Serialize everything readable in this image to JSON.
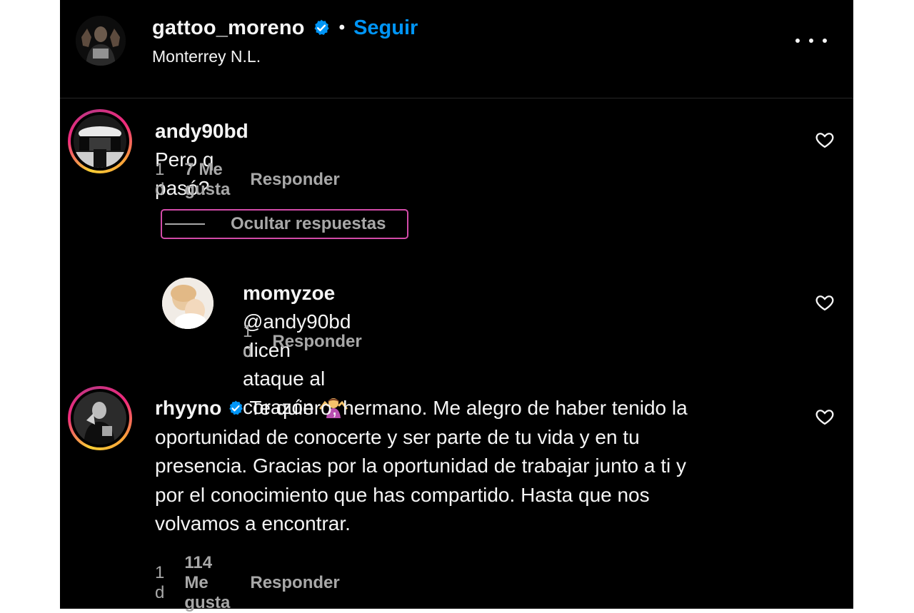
{
  "header": {
    "username": "gattoo_moreno",
    "separator": "•",
    "follow_label": "Seguir",
    "location": "Monterrey N.L.",
    "more_icon": "more-horizontal-icon"
  },
  "comments": [
    {
      "username": "andy90bd",
      "text": "Pero q pasó?",
      "time": "1 d",
      "likes": "7 Me gusta",
      "reply_label": "Responder"
    },
    {
      "username": "momyzoe",
      "text": "@andy90bd dicen ataque al corazón",
      "emoji": "🤷‍♀️",
      "time": "1 d",
      "reply_label": "Responder"
    },
    {
      "username": "rhyyno",
      "text_lines": [
        "Te quiero, hermano. Me alegro de haber tenido la",
        "oportunidad de conocerte y ser parte de tu vida y en tu",
        "presencia. Gracias por la oportunidad de trabajar junto a ti y",
        "por el conocimiento que has compartido. Hasta que nos",
        "volvamos a encontrar."
      ],
      "time": "1 d",
      "likes": "114 Me gusta",
      "reply_label": "Responder"
    }
  ],
  "hide_replies_label": "Ocultar respuestas",
  "colors": {
    "background": "#000000",
    "accent": "#0095f6",
    "secondary_text": "#a8a8a8",
    "highlight_border": "#d24ba8"
  }
}
